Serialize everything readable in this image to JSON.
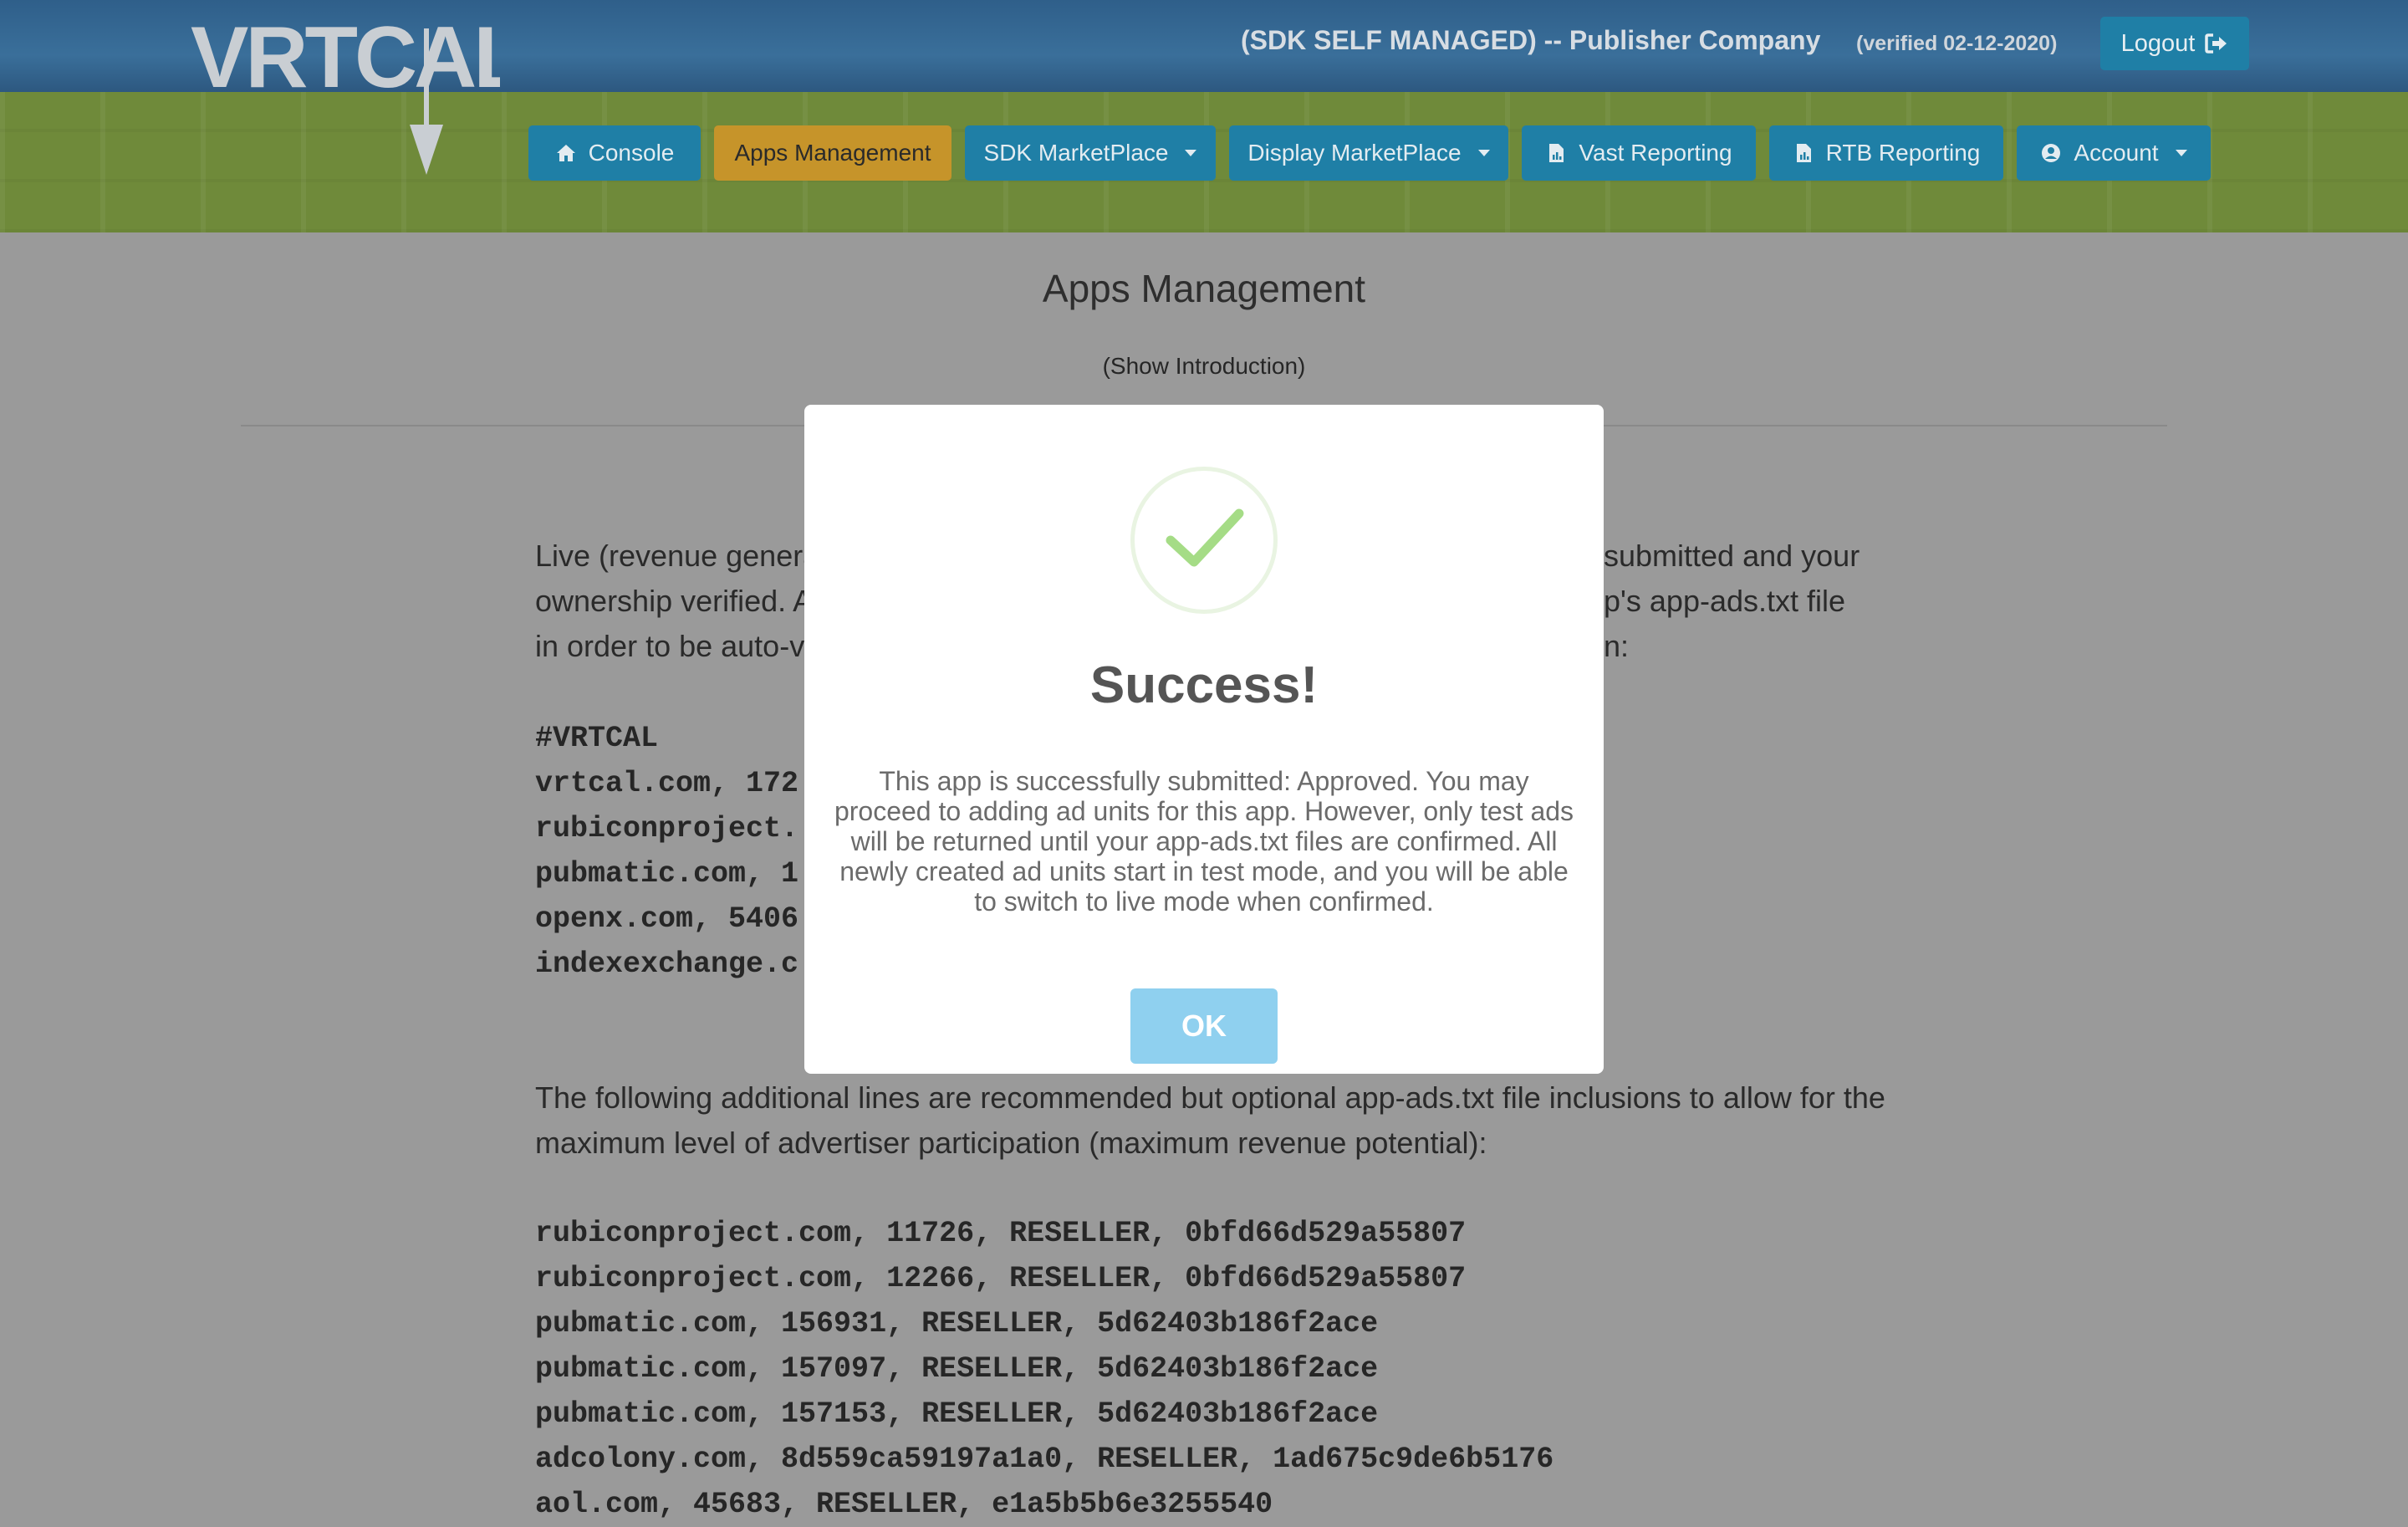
{
  "header": {
    "logo_text": "VRTCAL",
    "company": "(SDK SELF MANAGED) -- Publisher Company",
    "verified": "(verified 02-12-2020)",
    "logout_label": "Logout"
  },
  "nav": {
    "items": [
      {
        "label": "Console",
        "icon": "home-icon"
      },
      {
        "label": "Apps Management",
        "active": true
      },
      {
        "label": "SDK MarketPlace",
        "dropdown": true
      },
      {
        "label": "Display MarketPlace",
        "dropdown": true
      },
      {
        "label": "Vast Reporting",
        "icon": "file-chart-icon"
      },
      {
        "label": "RTB Reporting",
        "icon": "file-chart-icon"
      },
      {
        "label": "Account",
        "icon": "user-circle-icon",
        "dropdown": true
      }
    ]
  },
  "main": {
    "title": "Apps Management",
    "show_intro": "(Show Introduction)",
    "intro_lines": [
      "Live (revenue genera",
      "submitted and your",
      "ownership verified. A",
      "p's app-ads.txt file",
      "in order to be auto-v",
      "n:"
    ],
    "required_lines": [
      "#VRTCAL",
      "vrtcal.com, 172",
      "rubiconproject.",
      "pubmatic.com, 1",
      "openx.com, 5406",
      "indexexchange.c"
    ],
    "optional_intro": "The following additional lines are recommended but optional app-ads.txt file inclusions to allow for the maximum level of advertiser participation (maximum revenue potential):",
    "optional_lines": [
      "rubiconproject.com, 11726, RESELLER, 0bfd66d529a55807",
      "rubiconproject.com, 12266, RESELLER, 0bfd66d529a55807",
      "pubmatic.com, 156931, RESELLER, 5d62403b186f2ace",
      "pubmatic.com, 157097, RESELLER, 5d62403b186f2ace",
      "pubmatic.com, 157153, RESELLER, 5d62403b186f2ace",
      "adcolony.com, 8d559ca59197a1a0, RESELLER, 1ad675c9de6b5176",
      "aol.com, 45683, RESELLER, e1a5b5b6e3255540"
    ]
  },
  "modal": {
    "title": "Success!",
    "message": "This app is successfully submitted: Approved. You may proceed to adding ad units for this app. However, only test ads will be returned until your app-ads.txt files are confirmed. All newly created ad units start in test mode, and you will be able to switch to live mode when confirmed.",
    "ok_label": "OK",
    "icon": "check-icon"
  },
  "colors": {
    "nav_button": "#1f7fa6",
    "nav_active": "#c6942a",
    "success_green": "#a5dc86",
    "ok_button": "#8fd0ef"
  }
}
